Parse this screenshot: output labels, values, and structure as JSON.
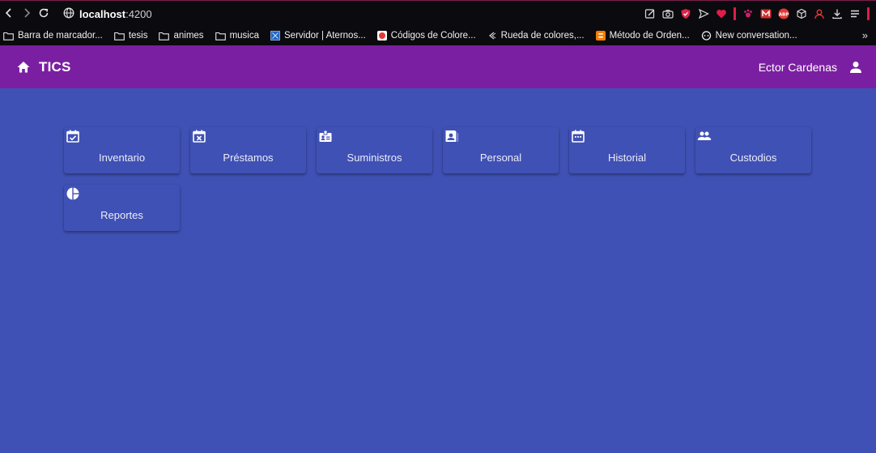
{
  "browser": {
    "url_host": "localhost",
    "url_port": ":4200",
    "bookmarks": [
      {
        "label": "Barra de marcador...",
        "icon": "folder-icon"
      },
      {
        "label": "tesis",
        "icon": "folder-icon"
      },
      {
        "label": "animes",
        "icon": "folder-icon"
      },
      {
        "label": "musica",
        "icon": "folder-icon"
      },
      {
        "label": "Servidor | Aternos...",
        "icon": "aternos-icon"
      },
      {
        "label": "Códigos de Colore...",
        "icon": "red-favicon"
      },
      {
        "label": "Rueda de colores,...",
        "icon": "wheel-icon"
      },
      {
        "label": "Método de Orden...",
        "icon": "blogger-icon"
      },
      {
        "label": "New conversation...",
        "icon": "chat-icon"
      }
    ],
    "more_symbol": "»"
  },
  "toolbar": {
    "title": "TICS",
    "user_name": "Ector Cardenas",
    "bg_color": "#7b1fa2"
  },
  "cards": [
    {
      "label": "Inventario",
      "icon": "event-available-icon"
    },
    {
      "label": "Préstamos",
      "icon": "event-busy-icon"
    },
    {
      "label": "Suministros",
      "icon": "badge-icon"
    },
    {
      "label": "Personal",
      "icon": "contact-page-icon"
    },
    {
      "label": "Historial",
      "icon": "calendar-icon"
    },
    {
      "label": "Custodios",
      "icon": "people-icon"
    },
    {
      "label": "Reportes",
      "icon": "pie-chart-icon"
    }
  ],
  "colors": {
    "background": "#3f51b5",
    "toolbar": "#7b1fa2"
  }
}
